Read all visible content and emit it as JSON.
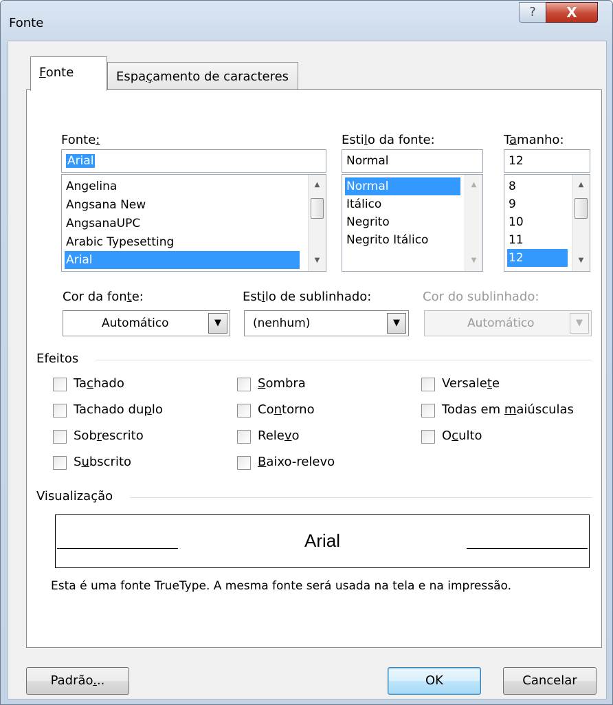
{
  "dialog": {
    "title": "Fonte",
    "help_symbol": "?",
    "close_symbol": "X"
  },
  "tabs": [
    {
      "label": "Fonte",
      "accel": "F",
      "rest": "onte"
    },
    {
      "label": "Espaçamento de caracteres",
      "pre": "Espa",
      "accel": "ç",
      "rest": "amento de caracteres"
    }
  ],
  "font": {
    "label_pre": "Fonte",
    "label_accel": ":",
    "value": "Arial",
    "items": [
      "Angelina",
      "Angsana New",
      "AngsanaUPC",
      "Arabic Typesetting",
      "Arial"
    ]
  },
  "style": {
    "label_pre": "Esti",
    "label_accel": "l",
    "label_rest": "o da fonte:",
    "value": "Normal",
    "items": [
      "Normal",
      "Itálico",
      "Negrito",
      "Negrito Itálico"
    ]
  },
  "size": {
    "label_pre": "T",
    "label_accel": "a",
    "label_rest": "manho:",
    "value": "12",
    "items": [
      "8",
      "9",
      "10",
      "11",
      "12"
    ]
  },
  "font_color": {
    "label_pre": "Cor da fon",
    "label_accel": "t",
    "label_rest": "e:",
    "value": "Automático"
  },
  "underline_style": {
    "label_pre": "Est",
    "label_accel": "i",
    "label_rest": "lo de sublinhado:",
    "value": "(nenhum)"
  },
  "underline_color": {
    "label": "Cor do sublinhado:",
    "value": "Automático"
  },
  "effects": {
    "heading": "Efeitos",
    "items": [
      {
        "pre": "Ta",
        "accel": "c",
        "rest": "hado"
      },
      {
        "pre": "Tachado du",
        "accel": "p",
        "rest": "lo"
      },
      {
        "pre": "Sob",
        "accel": "r",
        "rest": "escrito"
      },
      {
        "pre": "S",
        "accel": "u",
        "rest": "bscrito"
      },
      {
        "pre": "",
        "accel": "S",
        "rest": "ombra"
      },
      {
        "pre": "Co",
        "accel": "n",
        "rest": "torno"
      },
      {
        "pre": "Rele",
        "accel": "v",
        "rest": "o"
      },
      {
        "pre": "",
        "accel": "B",
        "rest": "aixo-relevo"
      },
      {
        "pre": "Versale",
        "accel": "t",
        "rest": "e"
      },
      {
        "pre": "Todas em ",
        "accel": "m",
        "rest": "aiúsculas"
      },
      {
        "pre": "O",
        "accel": "c",
        "rest": "ulto"
      }
    ]
  },
  "preview": {
    "heading": "Visualização",
    "sample": "Arial",
    "description": "Esta é uma fonte TrueType. A mesma fonte será usada na tela e na impressão."
  },
  "buttons": {
    "default_pre": "Padrão",
    "default_accel": ".",
    "default_rest": "..",
    "ok": "OK",
    "cancel": "Cancelar"
  }
}
